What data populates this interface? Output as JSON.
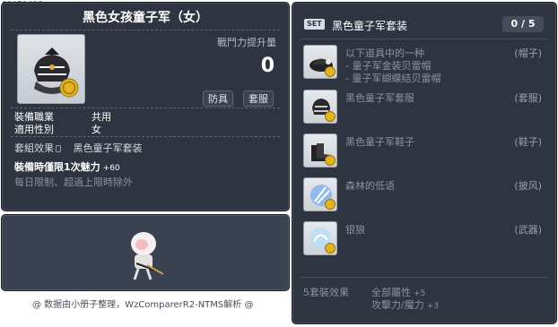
{
  "item_code": "01051498",
  "item": {
    "name": "黑色女孩童子军（女）",
    "attack_increase_label": "戰鬥力提升量",
    "attack_increase_value": "0",
    "category_buttons": [
      "防具",
      "套服"
    ]
  },
  "stats": {
    "job_label": "裝備職業",
    "job_value": "共用",
    "gender_label": "適用性別",
    "gender_value": "女",
    "set_effect_label": "套組效果",
    "set_effect_value": "黑色童子军套装"
  },
  "equip_bonus": {
    "text": "裝備時僅限1次魅力",
    "plus": "+60"
  },
  "limit_text": "每日限制、超過上限時除外",
  "footer": "@ 数据由小册子整理，WzComparerR2-NTMS解析 @",
  "set_panel": {
    "badge": "SET",
    "title": "黑色童子军套装",
    "count": "0 / 5",
    "parts": [
      {
        "name": "以下道具中的一种",
        "subs": [
          "- 童子军金装贝雷帽",
          "- 童子军蝴蝶结贝雷帽"
        ],
        "slot": "(帽子)",
        "icon": "hat-icon"
      },
      {
        "name": "黑色童子军套服",
        "subs": [],
        "slot": "(套服)",
        "icon": "outfit-icon"
      },
      {
        "name": "黑色童子军鞋子",
        "subs": [],
        "slot": "(鞋子)",
        "icon": "shoes-icon"
      },
      {
        "name": "森林的低语",
        "subs": [],
        "slot": "(披风)",
        "icon": "cape-icon"
      },
      {
        "name": "银狼",
        "subs": [],
        "slot": "(武器)",
        "icon": "weapon-icon"
      }
    ],
    "bonus": {
      "label": "5套裝效果",
      "lines": [
        {
          "text": "全部屬性",
          "plus": "+5"
        },
        {
          "text": "攻擊力/魔力",
          "plus": "+3"
        }
      ]
    }
  },
  "colors": {
    "panel_bg": "#2e3440",
    "preview_bg": "#3a4150",
    "muted_text": "#8c93a0",
    "coin_gold": "#e3b420"
  }
}
